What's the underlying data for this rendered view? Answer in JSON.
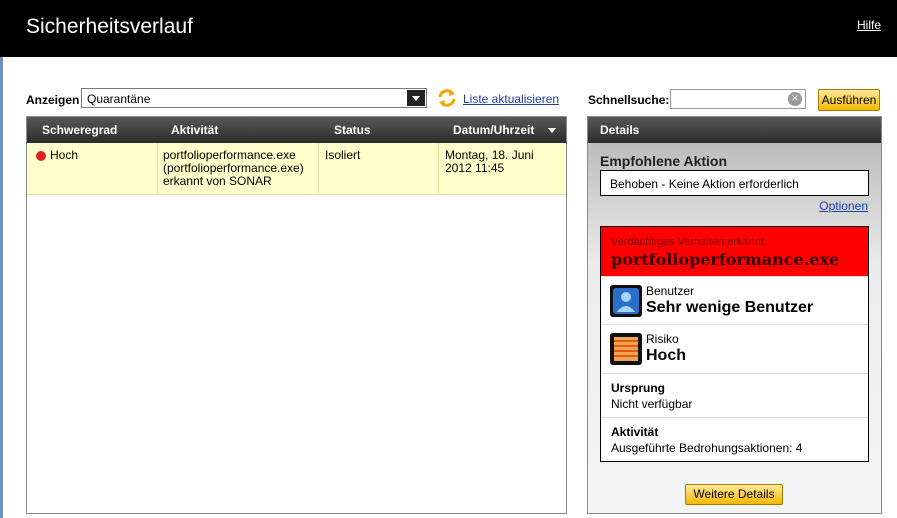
{
  "header": {
    "title": "Sicherheitsverlauf",
    "help_label": "Hilfe"
  },
  "filter": {
    "label": "Anzeigen",
    "selected": "Quarantäne",
    "refresh_label": "Liste aktualisieren"
  },
  "quicksearch": {
    "label": "Schnellsuche:",
    "value": "",
    "run_label": "Ausführen"
  },
  "table": {
    "columns": [
      "Schweregrad",
      "Aktivität",
      "Status",
      "Datum/Uhrzeit"
    ],
    "rows": [
      {
        "severity": "Hoch",
        "activity": [
          "portfolioperformance.exe",
          "(portfolioperformance.exe)",
          "erkannt von SONAR"
        ],
        "status": "Isoliert",
        "datetime": [
          "Montag, 18. Juni",
          "2012 11:45"
        ]
      }
    ]
  },
  "details": {
    "header": "Details",
    "recommended_title": "Empfohlene Aktion",
    "recommended_value": "Behoben - Keine Aktion erforderlich",
    "options_label": "Optionen",
    "threat_subtitle": "Verdächtiges Verhalten erkannt:",
    "threat_name": "portfolioperformance.exe",
    "users_label": "Benutzer",
    "users_value": "Sehr wenige Benutzer",
    "risk_label": "Risiko",
    "risk_value": "Hoch",
    "origin_label": "Ursprung",
    "origin_value": "Nicht verfügbar",
    "activity_label": "Aktivität",
    "activity_value": "Ausgeführte Bedrohungsaktionen: 4",
    "more_label": "Weitere Details"
  },
  "colors": {
    "severity_high": "#e02020",
    "threat_banner": "#ff0000",
    "row_highlight": "#ffffcc",
    "link": "#1a3fa8"
  },
  "icons": {
    "refresh": "refresh-icon",
    "clear": "clear-icon",
    "users": "user-icon",
    "risk": "risk-icon",
    "dropdown": "chevron-down-icon"
  }
}
